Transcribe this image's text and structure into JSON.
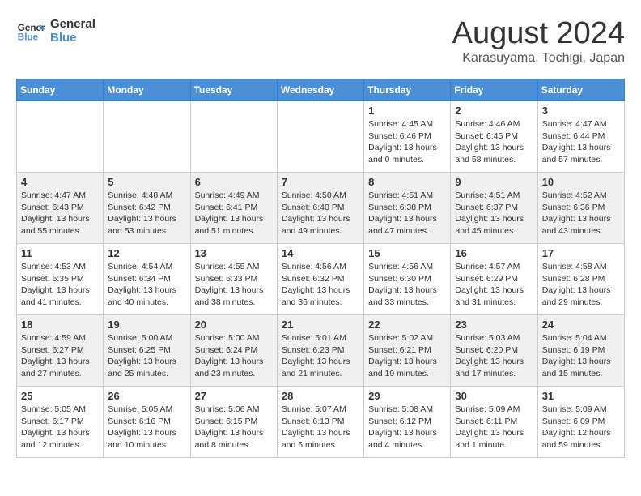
{
  "header": {
    "logo": {
      "line1": "General",
      "line2": "Blue"
    },
    "title": "August 2024",
    "subtitle": "Karasuyama, Tochigi, Japan"
  },
  "days_of_week": [
    "Sunday",
    "Monday",
    "Tuesday",
    "Wednesday",
    "Thursday",
    "Friday",
    "Saturday"
  ],
  "weeks": [
    [
      {
        "day": "",
        "info": ""
      },
      {
        "day": "",
        "info": ""
      },
      {
        "day": "",
        "info": ""
      },
      {
        "day": "",
        "info": ""
      },
      {
        "day": "1",
        "info": "Sunrise: 4:45 AM\nSunset: 6:46 PM\nDaylight: 13 hours\nand 0 minutes."
      },
      {
        "day": "2",
        "info": "Sunrise: 4:46 AM\nSunset: 6:45 PM\nDaylight: 13 hours\nand 58 minutes."
      },
      {
        "day": "3",
        "info": "Sunrise: 4:47 AM\nSunset: 6:44 PM\nDaylight: 13 hours\nand 57 minutes."
      }
    ],
    [
      {
        "day": "4",
        "info": "Sunrise: 4:47 AM\nSunset: 6:43 PM\nDaylight: 13 hours\nand 55 minutes."
      },
      {
        "day": "5",
        "info": "Sunrise: 4:48 AM\nSunset: 6:42 PM\nDaylight: 13 hours\nand 53 minutes."
      },
      {
        "day": "6",
        "info": "Sunrise: 4:49 AM\nSunset: 6:41 PM\nDaylight: 13 hours\nand 51 minutes."
      },
      {
        "day": "7",
        "info": "Sunrise: 4:50 AM\nSunset: 6:40 PM\nDaylight: 13 hours\nand 49 minutes."
      },
      {
        "day": "8",
        "info": "Sunrise: 4:51 AM\nSunset: 6:38 PM\nDaylight: 13 hours\nand 47 minutes."
      },
      {
        "day": "9",
        "info": "Sunrise: 4:51 AM\nSunset: 6:37 PM\nDaylight: 13 hours\nand 45 minutes."
      },
      {
        "day": "10",
        "info": "Sunrise: 4:52 AM\nSunset: 6:36 PM\nDaylight: 13 hours\nand 43 minutes."
      }
    ],
    [
      {
        "day": "11",
        "info": "Sunrise: 4:53 AM\nSunset: 6:35 PM\nDaylight: 13 hours\nand 41 minutes."
      },
      {
        "day": "12",
        "info": "Sunrise: 4:54 AM\nSunset: 6:34 PM\nDaylight: 13 hours\nand 40 minutes."
      },
      {
        "day": "13",
        "info": "Sunrise: 4:55 AM\nSunset: 6:33 PM\nDaylight: 13 hours\nand 38 minutes."
      },
      {
        "day": "14",
        "info": "Sunrise: 4:56 AM\nSunset: 6:32 PM\nDaylight: 13 hours\nand 36 minutes."
      },
      {
        "day": "15",
        "info": "Sunrise: 4:56 AM\nSunset: 6:30 PM\nDaylight: 13 hours\nand 33 minutes."
      },
      {
        "day": "16",
        "info": "Sunrise: 4:57 AM\nSunset: 6:29 PM\nDaylight: 13 hours\nand 31 minutes."
      },
      {
        "day": "17",
        "info": "Sunrise: 4:58 AM\nSunset: 6:28 PM\nDaylight: 13 hours\nand 29 minutes."
      }
    ],
    [
      {
        "day": "18",
        "info": "Sunrise: 4:59 AM\nSunset: 6:27 PM\nDaylight: 13 hours\nand 27 minutes."
      },
      {
        "day": "19",
        "info": "Sunrise: 5:00 AM\nSunset: 6:25 PM\nDaylight: 13 hours\nand 25 minutes."
      },
      {
        "day": "20",
        "info": "Sunrise: 5:00 AM\nSunset: 6:24 PM\nDaylight: 13 hours\nand 23 minutes."
      },
      {
        "day": "21",
        "info": "Sunrise: 5:01 AM\nSunset: 6:23 PM\nDaylight: 13 hours\nand 21 minutes."
      },
      {
        "day": "22",
        "info": "Sunrise: 5:02 AM\nSunset: 6:21 PM\nDaylight: 13 hours\nand 19 minutes."
      },
      {
        "day": "23",
        "info": "Sunrise: 5:03 AM\nSunset: 6:20 PM\nDaylight: 13 hours\nand 17 minutes."
      },
      {
        "day": "24",
        "info": "Sunrise: 5:04 AM\nSunset: 6:19 PM\nDaylight: 13 hours\nand 15 minutes."
      }
    ],
    [
      {
        "day": "25",
        "info": "Sunrise: 5:05 AM\nSunset: 6:17 PM\nDaylight: 13 hours\nand 12 minutes."
      },
      {
        "day": "26",
        "info": "Sunrise: 5:05 AM\nSunset: 6:16 PM\nDaylight: 13 hours\nand 10 minutes."
      },
      {
        "day": "27",
        "info": "Sunrise: 5:06 AM\nSunset: 6:15 PM\nDaylight: 13 hours\nand 8 minutes."
      },
      {
        "day": "28",
        "info": "Sunrise: 5:07 AM\nSunset: 6:13 PM\nDaylight: 13 hours\nand 6 minutes."
      },
      {
        "day": "29",
        "info": "Sunrise: 5:08 AM\nSunset: 6:12 PM\nDaylight: 13 hours\nand 4 minutes."
      },
      {
        "day": "30",
        "info": "Sunrise: 5:09 AM\nSunset: 6:11 PM\nDaylight: 13 hours\nand 1 minute."
      },
      {
        "day": "31",
        "info": "Sunrise: 5:09 AM\nSunset: 6:09 PM\nDaylight: 12 hours\nand 59 minutes."
      }
    ]
  ]
}
